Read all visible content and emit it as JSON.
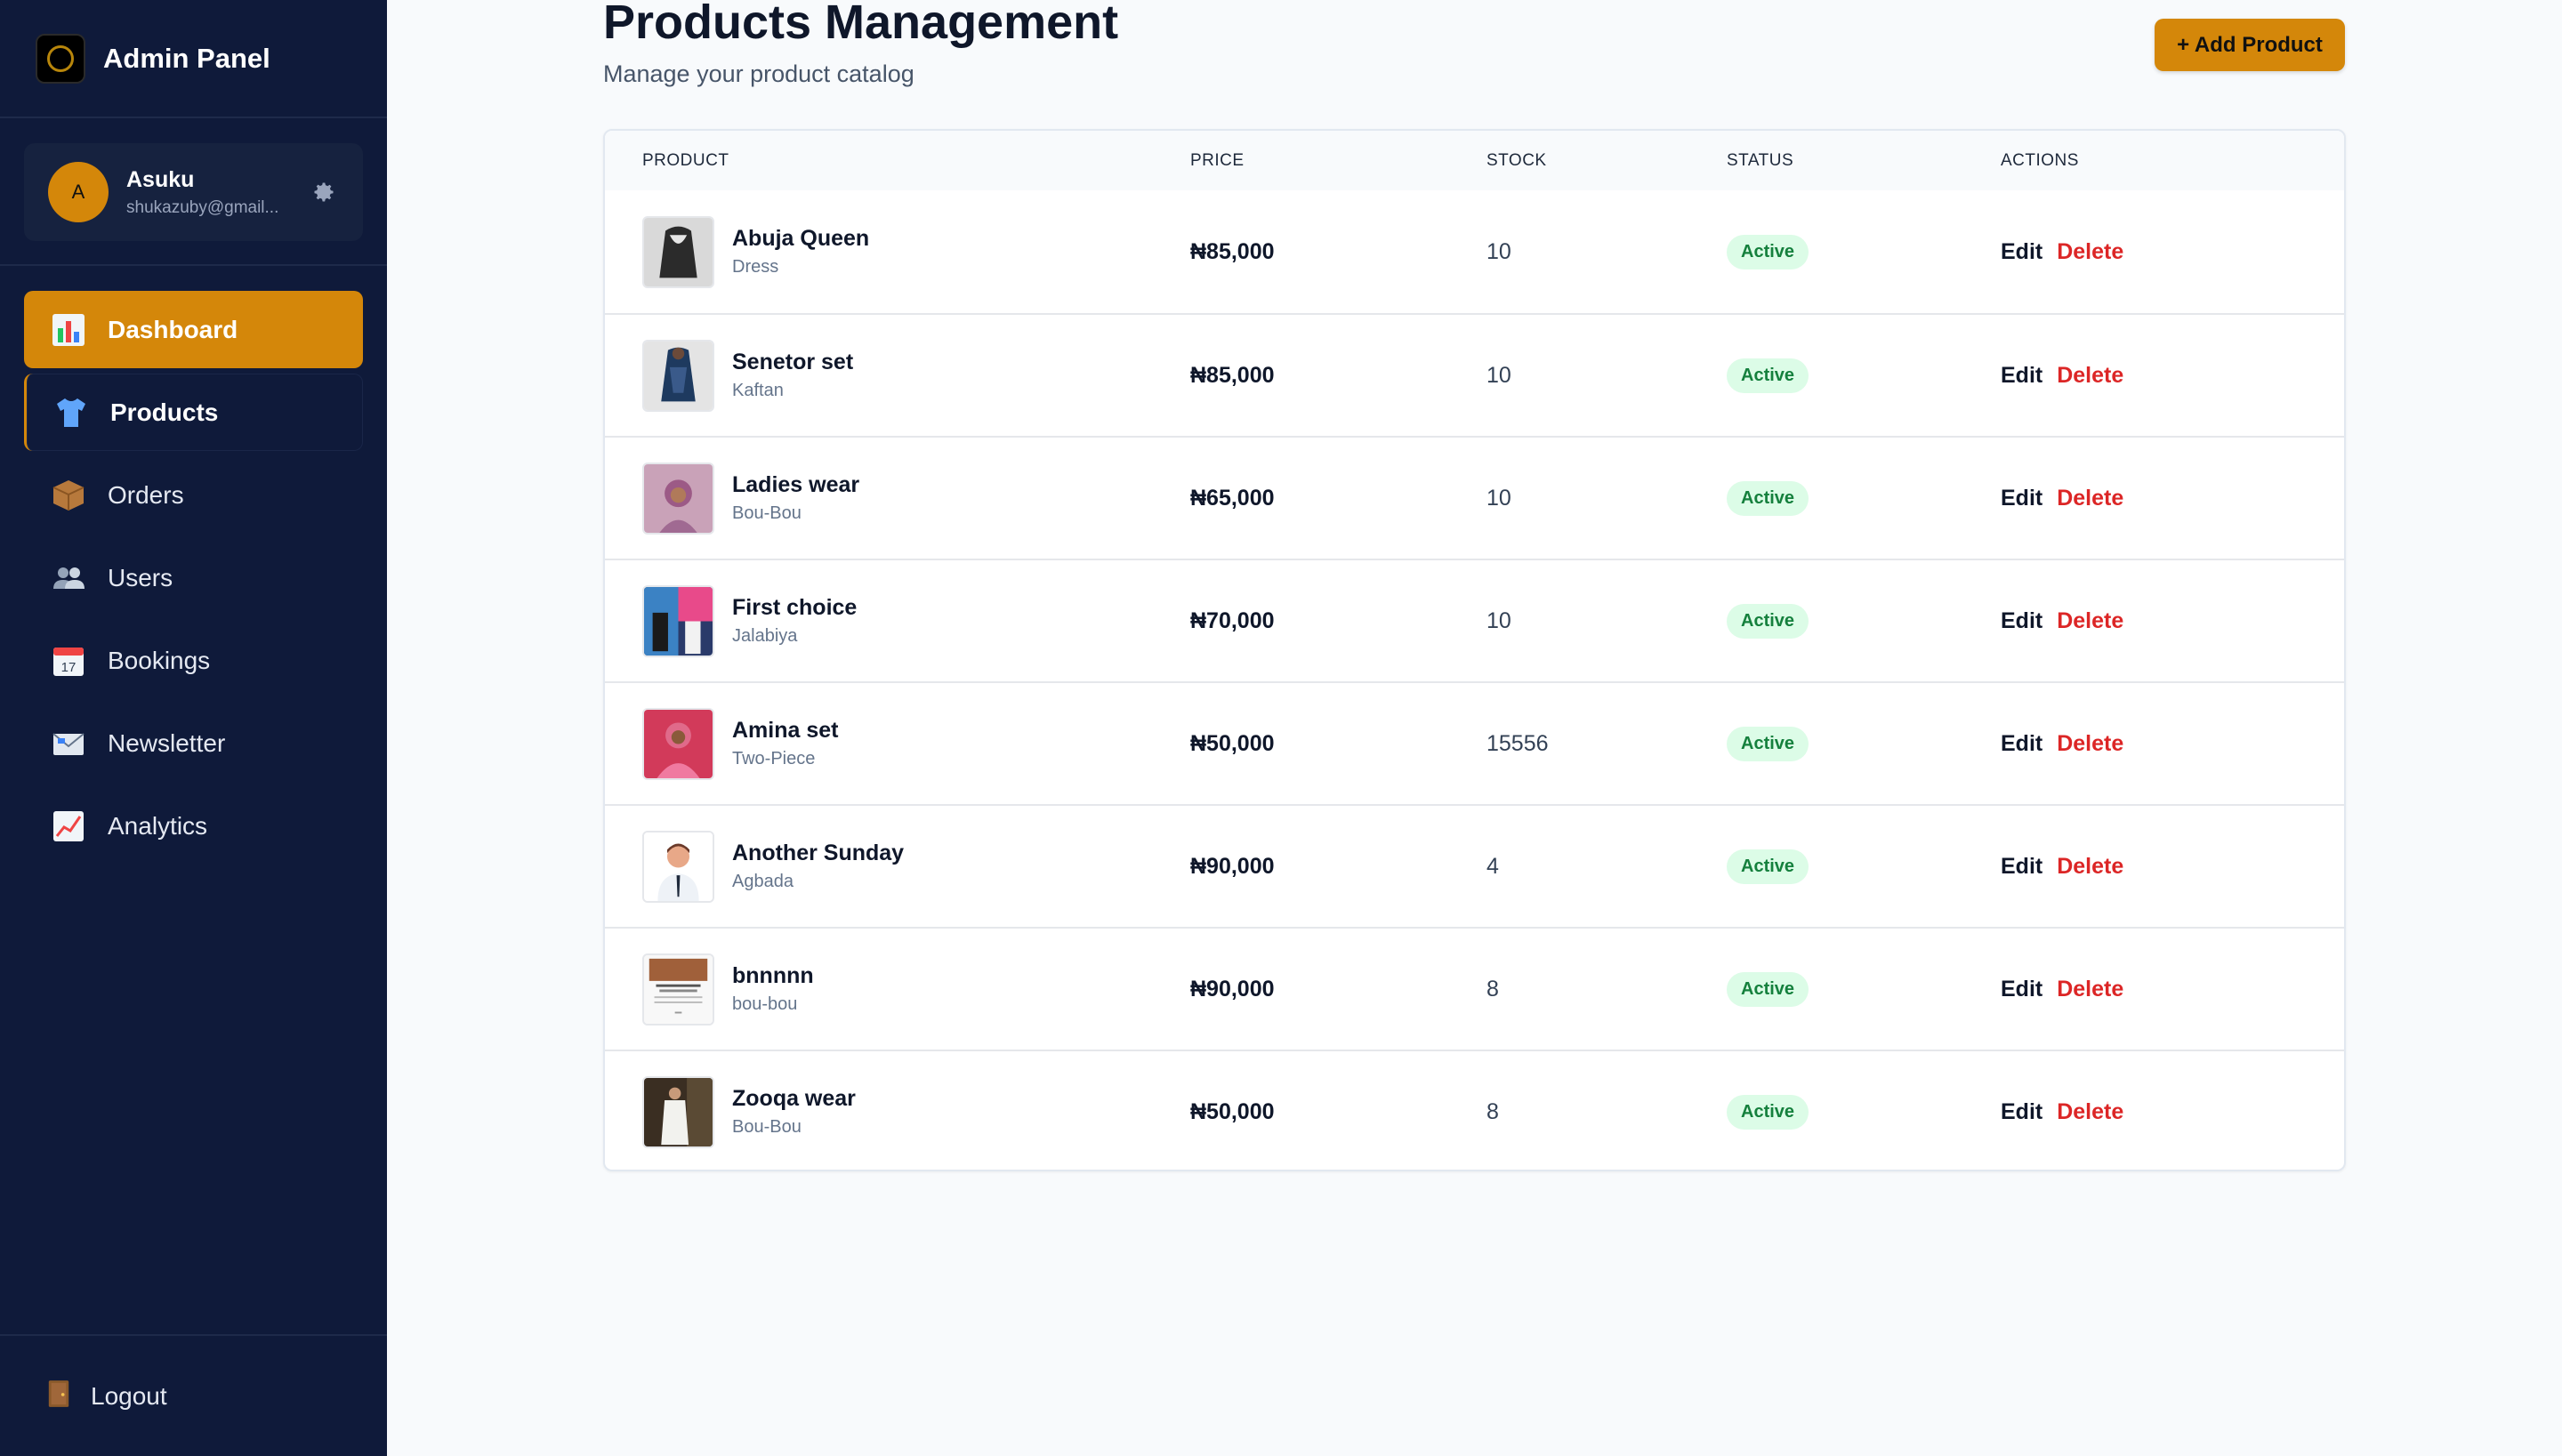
{
  "brand": {
    "title": "Admin Panel",
    "logo_icon": "brand-logo-icon"
  },
  "user": {
    "initial": "A",
    "name": "Asuku",
    "email": "shukazuby@gmail...",
    "settings_icon": "gear-icon"
  },
  "sidebar": {
    "items": [
      {
        "label": "Dashboard",
        "icon": "bar-chart-icon",
        "state": "active"
      },
      {
        "label": "Products",
        "icon": "tshirt-icon",
        "state": "hover"
      },
      {
        "label": "Orders",
        "icon": "package-icon",
        "state": ""
      },
      {
        "label": "Users",
        "icon": "users-icon",
        "state": ""
      },
      {
        "label": "Bookings",
        "icon": "calendar-icon",
        "state": ""
      },
      {
        "label": "Newsletter",
        "icon": "envelope-icon",
        "state": ""
      },
      {
        "label": "Analytics",
        "icon": "chart-up-icon",
        "state": ""
      }
    ],
    "logout_label": "Logout",
    "logout_icon": "door-icon"
  },
  "header": {
    "title": "Products Management",
    "subtitle": "Manage your product catalog",
    "add_button": "+ Add Product"
  },
  "table": {
    "columns": [
      "PRODUCT",
      "PRICE",
      "STOCK",
      "STATUS",
      "ACTIONS"
    ],
    "rows": [
      {
        "name": "Abuja Queen",
        "category": "Dress",
        "price": "₦85,000",
        "stock": "10",
        "status": "Active",
        "edit": "Edit",
        "delete": "Delete"
      },
      {
        "name": "Senetor set",
        "category": "Kaftan",
        "price": "₦85,000",
        "stock": "10",
        "status": "Active",
        "edit": "Edit",
        "delete": "Delete"
      },
      {
        "name": "Ladies wear",
        "category": "Bou-Bou",
        "price": "₦65,000",
        "stock": "10",
        "status": "Active",
        "edit": "Edit",
        "delete": "Delete"
      },
      {
        "name": "First choice",
        "category": "Jalabiya",
        "price": "₦70,000",
        "stock": "10",
        "status": "Active",
        "edit": "Edit",
        "delete": "Delete"
      },
      {
        "name": "Amina set",
        "category": "Two-Piece",
        "price": "₦50,000",
        "stock": "15556",
        "status": "Active",
        "edit": "Edit",
        "delete": "Delete"
      },
      {
        "name": "Another Sunday",
        "category": "Agbada",
        "price": "₦90,000",
        "stock": "4",
        "status": "Active",
        "edit": "Edit",
        "delete": "Delete"
      },
      {
        "name": "bnnnnn",
        "category": "bou-bou",
        "price": "₦90,000",
        "stock": "8",
        "status": "Active",
        "edit": "Edit",
        "delete": "Delete"
      },
      {
        "name": "Zooqa wear",
        "category": "Bou-Bou",
        "price": "₦50,000",
        "stock": "8",
        "status": "Active",
        "edit": "Edit",
        "delete": "Delete"
      }
    ]
  },
  "colors": {
    "sidebar_bg": "#0f1a3a",
    "accent": "#d4870a",
    "status_active_bg": "#dcfce7",
    "status_active_text": "#15803d",
    "delete_red": "#dc2626"
  }
}
